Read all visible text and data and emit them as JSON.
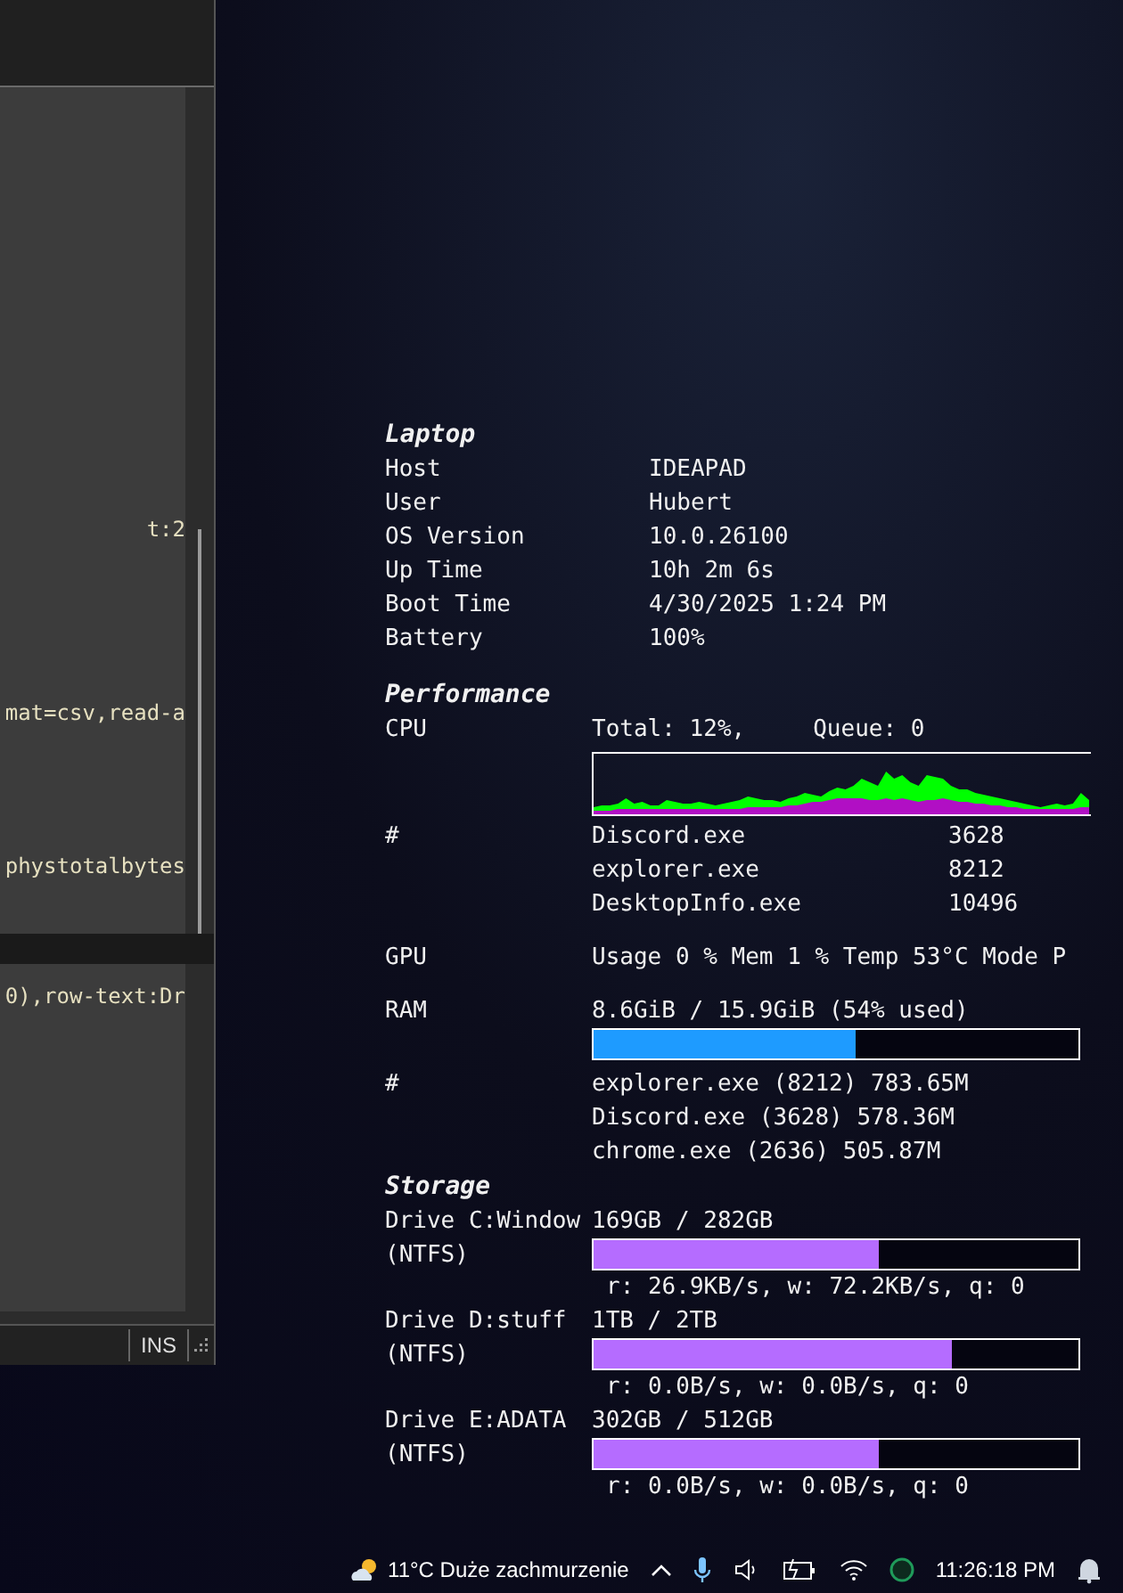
{
  "editor": {
    "code_lines": [
      "t:2",
      "mat=csv,read-a",
      "phystotalbytes"
    ],
    "lower_pane_lines": [
      "0),row-text:Dr"
    ],
    "status": "INS"
  },
  "widget": {
    "laptop": {
      "title": "Laptop",
      "rows": [
        {
          "label": "Host",
          "value": "IDEAPAD"
        },
        {
          "label": "User",
          "value": "Hubert"
        },
        {
          "label": "OS Version",
          "value": "10.0.26100"
        },
        {
          "label": "Up Time",
          "value": "10h 2m 6s"
        },
        {
          "label": "Boot Time",
          "value": "4/30/2025 1:24 PM"
        },
        {
          "label": "Battery",
          "value": "100%"
        }
      ]
    },
    "performance": {
      "title": "Performance",
      "cpu": {
        "label": "CPU",
        "total": "Total: 12%,",
        "queue": "Queue: 0"
      },
      "cpu_processes": {
        "label": "#",
        "rows": [
          {
            "name": "Discord.exe",
            "pid": "3628"
          },
          {
            "name": "explorer.exe",
            "pid": "8212"
          },
          {
            "name": "DesktopInfo.exe",
            "pid": "10496"
          }
        ]
      },
      "gpu": {
        "label": "GPU",
        "value": "Usage 0 % Mem 1 % Temp 53°C Mode P"
      },
      "ram": {
        "label": "RAM",
        "value": "8.6GiB / 15.9GiB (54% used)",
        "level": 0.54
      },
      "ram_processes": {
        "label": "#",
        "rows": [
          "explorer.exe (8212) 783.65M",
          "Discord.exe (3628) 578.36M",
          "chrome.exe (2636) 505.87M"
        ]
      }
    },
    "storage": {
      "title": "Storage",
      "drives": [
        {
          "name": "Drive C:Window",
          "fs": "(NTFS)",
          "usage": "169GB / 282GB",
          "level": 0.59,
          "io": "r: 26.9KB/s, w: 72.2KB/s, q: 0"
        },
        {
          "name": "Drive D:stuff",
          "fs": "(NTFS)",
          "usage": "1TB / 2TB",
          "level": 0.74,
          "io": "r: 0.0B/s, w: 0.0B/s, q: 0"
        },
        {
          "name": "Drive E:ADATA",
          "fs": "(NTFS)",
          "usage": "302GB / 512GB",
          "level": 0.59,
          "io": "r: 0.0B/s, w: 0.0B/s, q: 0"
        }
      ]
    }
  },
  "taskbar": {
    "weather": "11°C Duże zachmurzenie",
    "time": "11:26:18 PM"
  }
}
